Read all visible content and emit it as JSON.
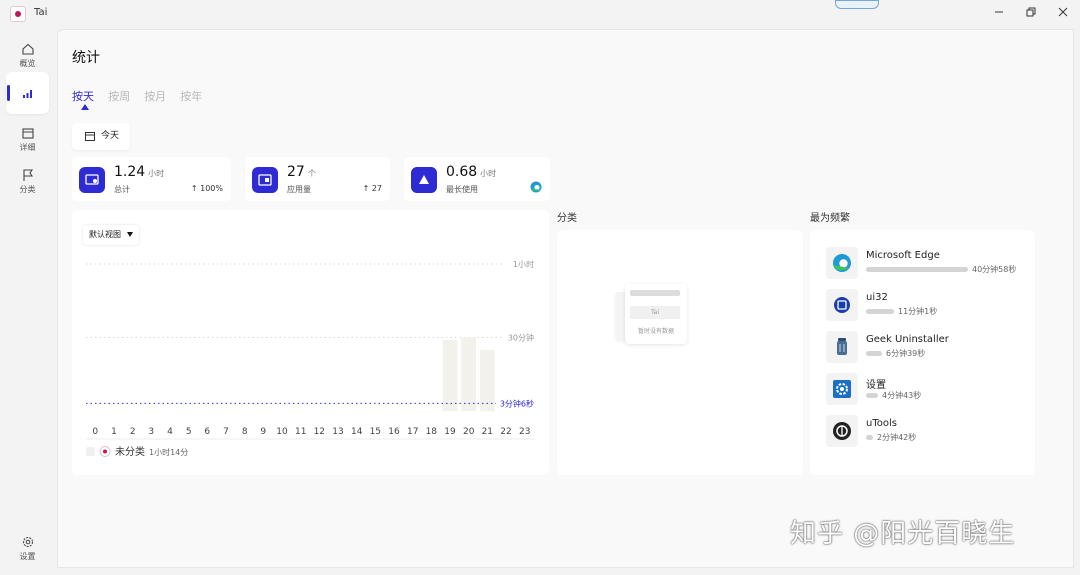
{
  "app": {
    "title": "Tai"
  },
  "sidebar": {
    "items": [
      {
        "label": "概览",
        "icon": "home-icon"
      },
      {
        "label": "",
        "icon": "chart-bars-icon"
      },
      {
        "label": "详细",
        "icon": "calendar-icon"
      },
      {
        "label": "分类",
        "icon": "flag-icon"
      },
      {
        "label": "设置",
        "icon": "gear-icon"
      }
    ]
  },
  "page": {
    "title": "统计"
  },
  "tabs": [
    {
      "label": "按天",
      "active": true
    },
    {
      "label": "按周",
      "active": false
    },
    {
      "label": "按月",
      "active": false
    },
    {
      "label": "按年",
      "active": false
    }
  ],
  "date_button": {
    "label": "今天"
  },
  "stats": [
    {
      "value": "1.24",
      "unit": "小时",
      "label": "总计",
      "change": "100%"
    },
    {
      "value": "27",
      "unit": "个",
      "label": "应用量",
      "change": "27"
    },
    {
      "value": "0.68",
      "unit": "小时",
      "label": "最长使用",
      "change": ""
    }
  ],
  "view_dropdown": {
    "label": "默认视图"
  },
  "chart_data": {
    "type": "bar",
    "categories": [
      "0",
      "1",
      "2",
      "3",
      "4",
      "5",
      "6",
      "7",
      "8",
      "9",
      "10",
      "11",
      "12",
      "13",
      "14",
      "15",
      "16",
      "17",
      "18",
      "19",
      "20",
      "21",
      "22",
      "23"
    ],
    "values": [
      0,
      0,
      0,
      0,
      0,
      0,
      0,
      0,
      0,
      0,
      0,
      0,
      0,
      0,
      0,
      0,
      0,
      0,
      0,
      29,
      30,
      25,
      0,
      0
    ],
    "ylim": [
      0,
      60
    ],
    "gridlines": [
      {
        "label": "1小时",
        "value": 60
      },
      {
        "label": "30分钟",
        "value": 30
      }
    ],
    "average": {
      "label": "3分钟6秒",
      "value": 3.1
    },
    "legend": [
      {
        "name": "未分类",
        "time": "1小时14分"
      }
    ],
    "grid": true,
    "colors": {
      "bar": "#f3f1ec",
      "average": "#2e2bd4"
    }
  },
  "category_section": {
    "title": "分类",
    "empty_chip": "Tai",
    "empty_text": "暂时没有数据"
  },
  "frequent_section": {
    "title": "最为频繁",
    "items": [
      {
        "name": "Microsoft Edge",
        "time": "40分钟58秒",
        "fraction": 1.0,
        "icon": "edge-icon"
      },
      {
        "name": "ui32",
        "time": "11分钟1秒",
        "fraction": 0.27,
        "icon": "app-icon"
      },
      {
        "name": "Geek Uninstaller",
        "time": "6分钟39秒",
        "fraction": 0.16,
        "icon": "trash-icon"
      },
      {
        "name": "设置",
        "time": "4分钟43秒",
        "fraction": 0.12,
        "icon": "settings-icon"
      },
      {
        "name": "uTools",
        "time": "2分钟42秒",
        "fraction": 0.066,
        "icon": "utools-icon"
      }
    ]
  },
  "watermark": {
    "text": "知乎 @阳光百晓生"
  },
  "colors": {
    "accent": "#2e2bd4"
  }
}
